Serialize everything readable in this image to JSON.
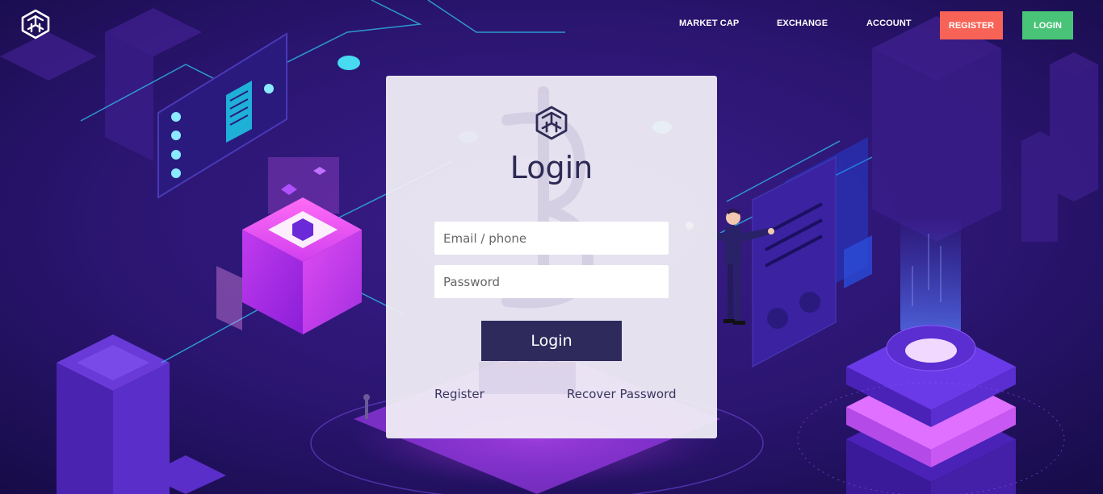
{
  "nav": {
    "links": [
      "MARKET CAP",
      "EXCHANGE",
      "ACCOUNT"
    ],
    "register_label": "REGISTER",
    "login_label": "LOGIN"
  },
  "colors": {
    "register_btn": "#f76356",
    "login_btn": "#49c378",
    "primary_btn": "#2e2a5c",
    "title_text": "#2d2a55"
  },
  "icons": {
    "brand": "hexagon-cube-logo-icon"
  },
  "login_card": {
    "title": "Login",
    "email_placeholder": "Email / phone",
    "password_placeholder": "Password",
    "submit_label": "Login",
    "register_link": "Register",
    "recover_link": "Recover Password"
  }
}
